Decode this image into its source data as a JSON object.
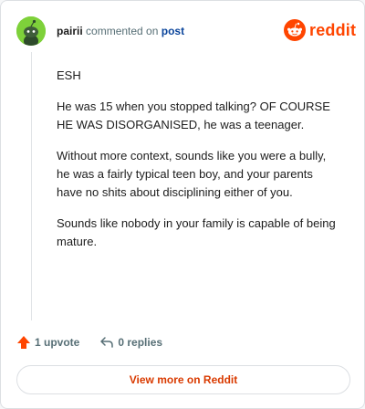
{
  "header": {
    "username": "pairii",
    "commented_on": "commented on",
    "post_link": "post"
  },
  "brand": {
    "name": "reddit",
    "color": "#ff4500"
  },
  "comment": {
    "paragraphs": [
      "ESH",
      "He was 15 when you stopped talking? OF COURSE HE WAS DISORGANISED, he was a teenager.",
      "Without more context, sounds like you were a bully, he was a fairly typical teen boy, and your parents have no shits about disciplining either of you.",
      "Sounds like nobody in your family is capable of being mature."
    ]
  },
  "actions": {
    "upvote_label": "1 upvote",
    "replies_label": "0 replies"
  },
  "footer": {
    "view_more_label": "View more on Reddit"
  }
}
